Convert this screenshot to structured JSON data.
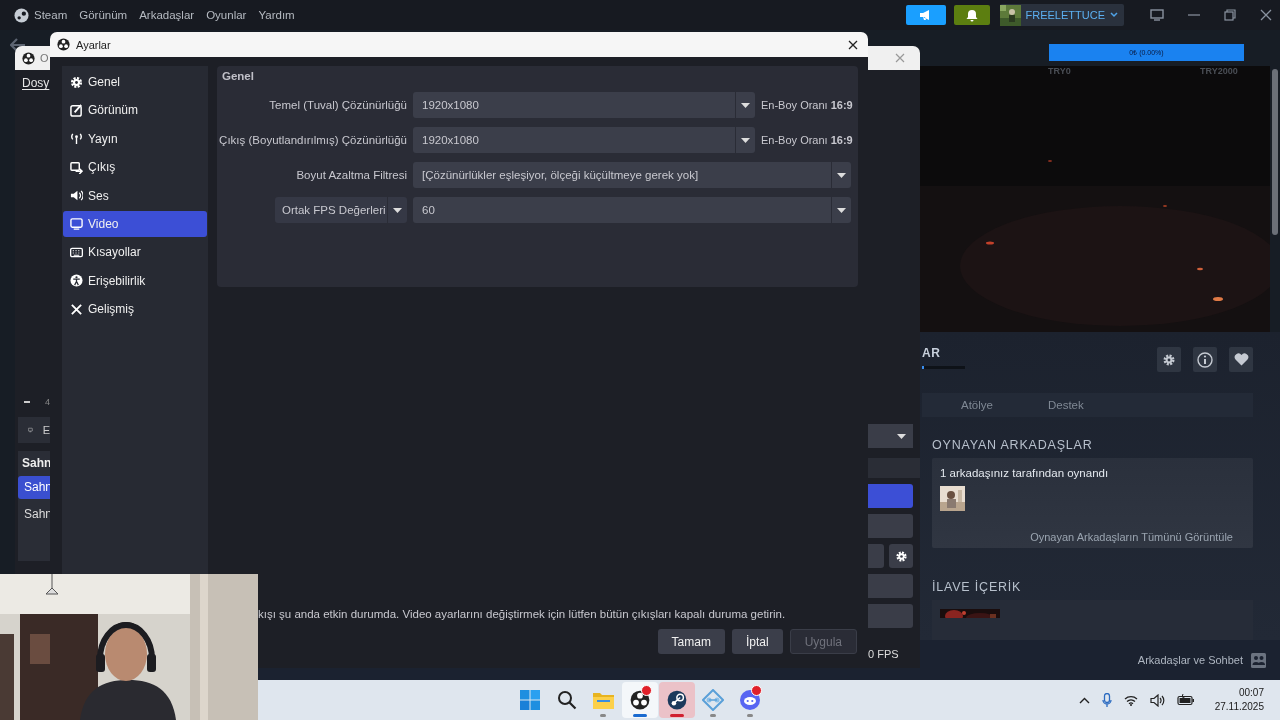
{
  "steam": {
    "menu": [
      "Steam",
      "Görünüm",
      "Arkadaşlar",
      "Oyunlar",
      "Yardım"
    ],
    "user": "FREELETTUCE",
    "price_bar": {
      "text": "0₺ (0.00%)",
      "min": "TRY0",
      "max": "TRY2000"
    },
    "section_heading": "AR",
    "section_progress": {
      "level": 0.05
    },
    "tabs": [
      {
        "label": "Atölye",
        "selected": false
      },
      {
        "label": "Destek",
        "selected": false
      }
    ],
    "friends": {
      "heading": "OYNAYAN ARKADAŞLAR",
      "summary": "1 arkadaşınız tarafından oynandı",
      "link": "Oynayan Arkadaşların Tümünü Görüntüle"
    },
    "dlc": {
      "heading": "İLAVE İÇERİK"
    },
    "chat_button": "Arkadaşlar ve Sohbet"
  },
  "obs": {
    "title": "O",
    "menu": [
      "Dosy"
    ],
    "volume_value": "4",
    "source_label": "E",
    "scenes_heading": "Sahn",
    "scenes": [
      {
        "label": "Sahn",
        "selected": true
      },
      {
        "label": "Sahn",
        "selected": false
      }
    ],
    "fps": "0 FPS"
  },
  "settings": {
    "title": "Ayarlar",
    "sidebar": [
      {
        "label": "Genel",
        "selected": false
      },
      {
        "label": "Görünüm",
        "selected": false
      },
      {
        "label": "Yayın",
        "selected": false
      },
      {
        "label": "Çıkış",
        "selected": false
      },
      {
        "label": "Ses",
        "selected": false
      },
      {
        "label": "Video",
        "selected": true
      },
      {
        "label": "Kısayollar",
        "selected": false
      },
      {
        "label": "Erişebilirlik",
        "selected": false
      },
      {
        "label": "Gelişmiş",
        "selected": false
      }
    ],
    "group": "Genel",
    "fields": [
      {
        "kind": "resolution",
        "label": "Temel (Tuval) Çözünürlüğü",
        "value": "1920x1080",
        "aspect": "En-Boy Oranı **16:9**"
      },
      {
        "kind": "resolution",
        "label": "Çıkış (Boyutlandırılmış) Çözünürlüğü",
        "value": "1920x1080",
        "aspect": "En-Boy Oranı **16:9**"
      },
      {
        "kind": "select",
        "label": "Boyut Azaltma Filtresi",
        "value": "[Çözünürlükler eşleşiyor, ölçeği küçültmeye gerek yok]"
      },
      {
        "kind": "fps",
        "mode": "Ortak FPS Değerleri",
        "value": "60"
      }
    ],
    "notice": "kışı şu anda etkin durumda. Video ayarlarını değiştirmek için lütfen bütün çıkışları kapalı duruma getirin.",
    "buttons": [
      {
        "label": "Tamam",
        "disabled": false
      },
      {
        "label": "İptal",
        "disabled": false
      },
      {
        "label": "Uygula",
        "disabled": true
      }
    ]
  },
  "taskbar": {
    "apps": [
      {
        "running": false,
        "selected": false,
        "attention": false,
        "badge": false
      },
      {
        "running": false,
        "selected": false,
        "attention": false,
        "badge": false
      },
      {
        "running": true,
        "selected": false,
        "attention": false,
        "badge": false
      },
      {
        "running": true,
        "selected": true,
        "attention": false,
        "badge": true
      },
      {
        "running": true,
        "selected": false,
        "attention": true,
        "badge": false
      },
      {
        "running": true,
        "selected": false,
        "attention": false,
        "badge": false
      },
      {
        "running": true,
        "selected": false,
        "attention": false,
        "badge": true
      }
    ],
    "time": "00:07",
    "date": "27.11.2025"
  }
}
